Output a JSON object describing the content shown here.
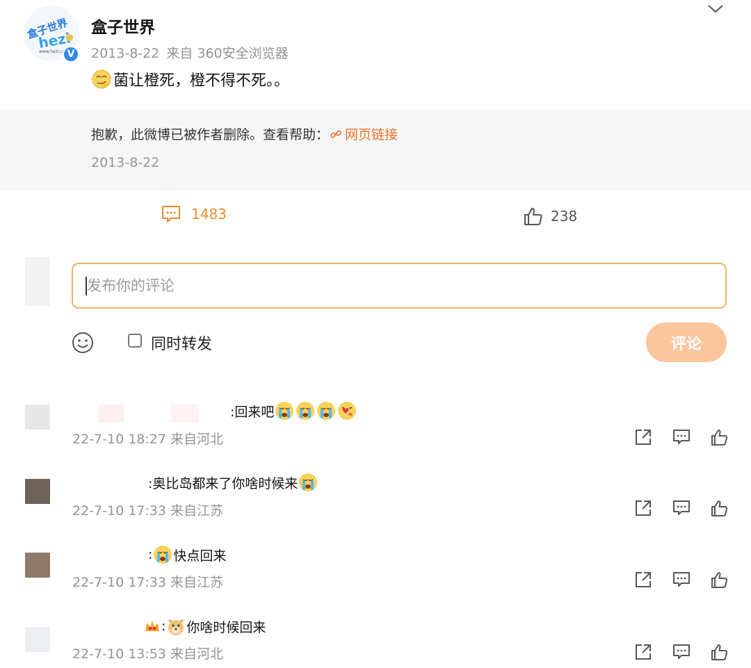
{
  "post": {
    "author": "盒子世界",
    "avatar_logo": "盒子世界 hezi",
    "verified_label": "V",
    "date": "2013-8-22",
    "source": "来自 360安全浏览器",
    "text": "菌让橙死，橙不得不死。。",
    "text_emoji": "smirk-emoji"
  },
  "deleted_repost": {
    "message": "抱歉，此微博已被作者删除。查看帮助：",
    "link_text": "网页链接",
    "date": "2013-8-22"
  },
  "actions": {
    "comment_count": "1483",
    "like_count": "238"
  },
  "compose": {
    "placeholder": "发布你的评论",
    "repost_label": "同时转发",
    "submit_label": "评论"
  },
  "comments": [
    {
      "text": ":回来吧",
      "emojis": [
        "crying-emoji",
        "crying-emoji",
        "crying-emoji",
        "sad-heart-emoji"
      ],
      "time": "22-7-10 18:27 来自河北",
      "avatar_color": "#e8e8e8"
    },
    {
      "text": ":奥比岛都来了你啥时候来",
      "emojis": [
        "crying-emoji"
      ],
      "time": "22-7-10 17:33 来自江苏",
      "avatar_color": "#6e6259"
    },
    {
      "text": "快点回来",
      "prefix": ":",
      "emojis": [
        "crying-emoji"
      ],
      "time": "22-7-10 17:33 来自江苏",
      "avatar_color": "#8f7b6c"
    },
    {
      "text": "你啥时候回来",
      "prefix": ":",
      "emojis": [
        "crown-badge",
        "doge-emoji"
      ],
      "time": "22-7-10 13:53 来自河北",
      "avatar_color": "#eceef2"
    }
  ],
  "colors": {
    "accent_orange": "#ee8a2c",
    "link_orange": "#e8722c",
    "input_border": "#f0b05e",
    "submit_bg": "#fbc69e",
    "meta_gray": "#939393"
  }
}
